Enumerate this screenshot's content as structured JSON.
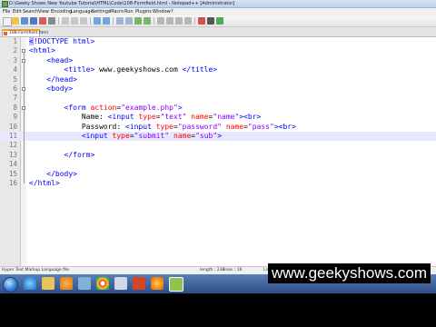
{
  "window": {
    "title": "D:\\Geeky Shows New Youtube Tutorial\\HTML\\Code\\108-Formfield.html - Notepad++ [Administrator]"
  },
  "menu": [
    "File",
    "Edit",
    "Search",
    "View",
    "Encoding",
    "Language",
    "Settings",
    "Macro",
    "Run",
    "Plugins",
    "Window",
    "?"
  ],
  "tab": {
    "label": "108-Formfield.html"
  },
  "editor": {
    "current_line": 11,
    "lines": [
      {
        "n": "1",
        "indent": 0,
        "parts": [
          [
            "tag",
            "<"
          ],
          [
            "tag",
            "!DOCTYPE html"
          ],
          [
            "tag",
            ">"
          ]
        ]
      },
      {
        "n": "2",
        "indent": 0,
        "parts": [
          [
            "tag",
            "<html>"
          ]
        ]
      },
      {
        "n": "3",
        "indent": 4,
        "parts": [
          [
            "tag",
            "<head>"
          ]
        ]
      },
      {
        "n": "4",
        "indent": 8,
        "parts": [
          [
            "tag",
            "<title>"
          ],
          [
            "txt",
            " www.geekyshows.com "
          ],
          [
            "tag",
            "</title>"
          ]
        ]
      },
      {
        "n": "5",
        "indent": 4,
        "parts": [
          [
            "tag",
            "</head>"
          ]
        ]
      },
      {
        "n": "6",
        "indent": 4,
        "parts": [
          [
            "tag",
            "<body>"
          ]
        ]
      },
      {
        "n": "7",
        "indent": 0,
        "parts": []
      },
      {
        "n": "8",
        "indent": 8,
        "parts": [
          [
            "tag",
            "<form "
          ],
          [
            "attr",
            "action"
          ],
          [
            "txt",
            "="
          ],
          [
            "val",
            "\"example.php\""
          ],
          [
            "tag",
            ">"
          ]
        ]
      },
      {
        "n": "9",
        "indent": 12,
        "parts": [
          [
            "txt",
            "Name: "
          ],
          [
            "tag",
            "<input "
          ],
          [
            "attr",
            "type"
          ],
          [
            "txt",
            "="
          ],
          [
            "val",
            "\"text\""
          ],
          [
            "txt",
            " "
          ],
          [
            "attr",
            "name"
          ],
          [
            "txt",
            "="
          ],
          [
            "val",
            "\"name\""
          ],
          [
            "tag",
            ">"
          ],
          [
            "tag",
            "<br>"
          ]
        ]
      },
      {
        "n": "10",
        "indent": 12,
        "parts": [
          [
            "txt",
            "Password: "
          ],
          [
            "tag",
            "<input "
          ],
          [
            "attr",
            "type"
          ],
          [
            "txt",
            "="
          ],
          [
            "val",
            "\"password\""
          ],
          [
            "txt",
            " "
          ],
          [
            "attr",
            "name"
          ],
          [
            "txt",
            "="
          ],
          [
            "val",
            "\"pass\""
          ],
          [
            "tag",
            ">"
          ],
          [
            "tag",
            "<br>"
          ]
        ]
      },
      {
        "n": "11",
        "indent": 12,
        "parts": [
          [
            "tag",
            "<input "
          ],
          [
            "attr",
            "type"
          ],
          [
            "txt",
            "="
          ],
          [
            "val",
            "\"submit\""
          ],
          [
            "txt",
            " "
          ],
          [
            "attr",
            "name"
          ],
          [
            "txt",
            "="
          ],
          [
            "val",
            "\"sub\""
          ],
          [
            "tag",
            ">"
          ]
        ]
      },
      {
        "n": "12",
        "indent": 0,
        "parts": []
      },
      {
        "n": "13",
        "indent": 8,
        "parts": [
          [
            "tag",
            "</form>"
          ]
        ]
      },
      {
        "n": "14",
        "indent": 0,
        "parts": []
      },
      {
        "n": "15",
        "indent": 4,
        "parts": [
          [
            "tag",
            "</body>"
          ]
        ]
      },
      {
        "n": "16",
        "indent": 0,
        "parts": [
          [
            "tag",
            "</html>"
          ]
        ]
      }
    ]
  },
  "status": {
    "file_type": "Hyper Text Markup Language file",
    "length": "length : 238",
    "lines": "lines : 16",
    "position": "Ln : 11",
    "col": "Col : 41",
    "sel": "Sel : 0 | 0"
  },
  "watermark": "www.geekyshows.com",
  "colors": {
    "tag": "#0000ff",
    "attr": "#ff0000",
    "value": "#8000ff",
    "current_line": "#e8e8ff",
    "taskbar": "#2b4f86"
  },
  "icons": [
    "notepadpp-icon",
    "start-orb-icon",
    "ie-icon",
    "explorer-icon",
    "media-player-icon",
    "chrome-icon",
    "firefox-icon",
    "notepadpp-taskbar-icon"
  ]
}
